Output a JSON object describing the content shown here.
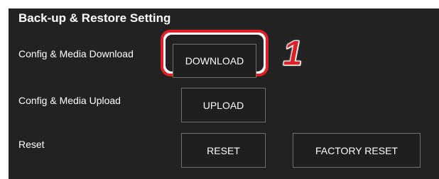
{
  "section": {
    "title": "Back-up & Restore Setting"
  },
  "rows": {
    "download": {
      "label": "Config & Media Download",
      "button": "DOWNLOAD"
    },
    "upload": {
      "label": "Config & Media Upload",
      "button": "UPLOAD"
    },
    "reset": {
      "label": "Reset",
      "button": "RESET",
      "factory_button": "FACTORY RESET"
    }
  },
  "annotation": {
    "step_number": "1",
    "highlight_color": "#e01f26"
  },
  "colors": {
    "panel_background": "#222222",
    "text": "#ffffff",
    "button_border": "#6f6f6f"
  }
}
